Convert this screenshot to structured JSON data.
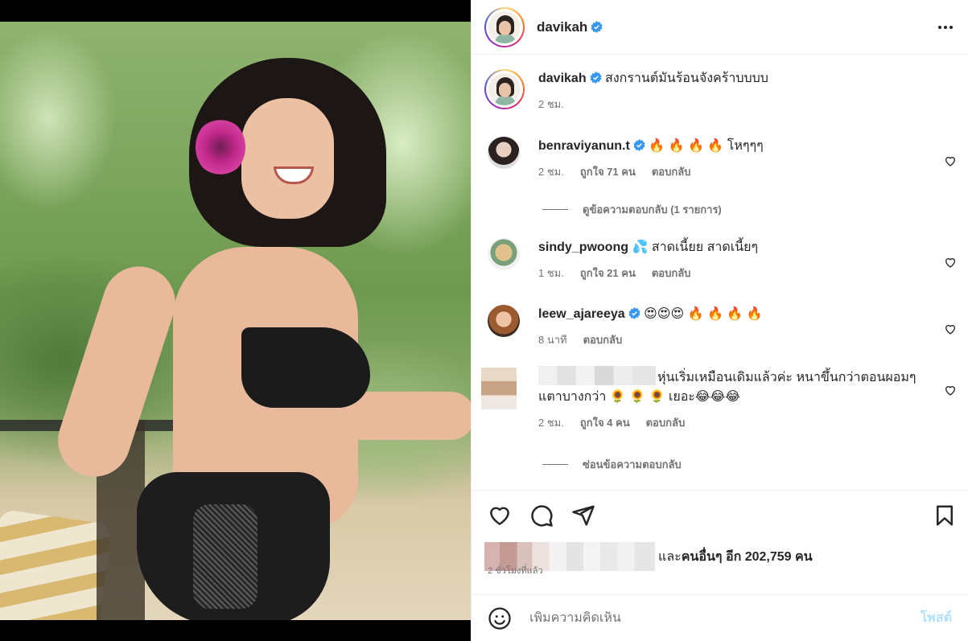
{
  "post": {
    "author": "davikah",
    "caption": "สงกรานต์มันร้อนจังคร้าบบบบ",
    "caption_time": "2 ชม."
  },
  "comments": [
    {
      "username": "benraviyanun.t",
      "verified": true,
      "text": "🔥 🔥 🔥 🔥 โหๆๆๆ",
      "time": "2 ชม.",
      "likes": "ถูกใจ 71 คน",
      "reply": "ตอบกลับ",
      "replies_toggle": "ดูข้อความตอบกลับ (1 รายการ)"
    },
    {
      "username": "sindy_pwoong",
      "verified": false,
      "text": "💦 สาดเนี้ยย สาดเนี้ยๆ",
      "time": "1 ชม.",
      "likes": "ถูกใจ 21 คน",
      "reply": "ตอบกลับ"
    },
    {
      "username": "leew_ajareeya",
      "verified": true,
      "text": "😍😍😍 🔥 🔥 🔥 🔥",
      "time": "8 นาที",
      "reply": "ตอบกลับ"
    },
    {
      "username": "",
      "verified": false,
      "text": "หุ่นเริ่มเหมือนเดิมแล้วค่ะ หนาขึ้นกว่าตอนผอมๆ แตาบางกว่า 🌻 🌻 🌻 เยอะ😂😂😂",
      "time": "2 ชม.",
      "likes": "ถูกใจ 4 คน",
      "reply": "ตอบกลับ",
      "replies_toggle": "ซ่อนข้อความตอบกลับ"
    }
  ],
  "likes_summary": {
    "prefix": "และ",
    "bold": "คนอื่นๆ",
    "suffix": "อีก 202,759 คน"
  },
  "posted_ago": "2 ชั่วโมงที่แล้ว",
  "add_comment": {
    "placeholder": "เพิ่มความคิดเห็น",
    "post_label": "โพสต์"
  },
  "icons": {
    "more": "more-horizontal-icon",
    "like": "heart-icon",
    "comment": "comment-bubble-icon",
    "share": "paper-plane-icon",
    "save": "bookmark-icon",
    "emoji": "smiley-icon",
    "verified": "verified-badge-icon"
  },
  "colors": {
    "verified": "#3897f0",
    "muted": "#737373",
    "post_button_disabled": "#b2dffc"
  }
}
